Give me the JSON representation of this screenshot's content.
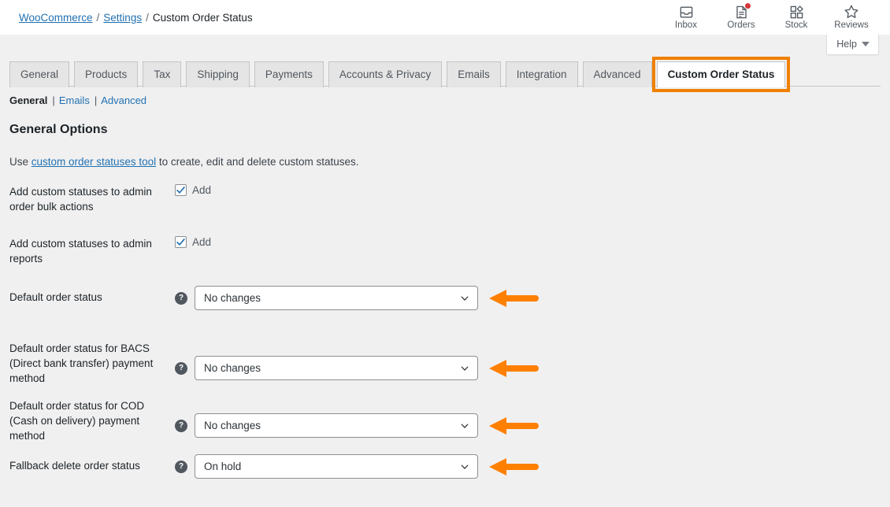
{
  "header": {
    "breadcrumb": {
      "root_label": "WooCommerce",
      "sep1": "/",
      "settings_label": "Settings",
      "sep2": "/",
      "current_label": "Custom Order Status"
    },
    "icons": [
      {
        "label": "Inbox",
        "icon": "inbox-icon",
        "badge": false
      },
      {
        "label": "Orders",
        "icon": "orders-icon",
        "badge": true
      },
      {
        "label": "Stock",
        "icon": "stock-icon",
        "badge": false
      },
      {
        "label": "Reviews",
        "icon": "reviews-star-icon",
        "badge": false
      }
    ],
    "help_label": "Help"
  },
  "tabs": [
    {
      "label": "General",
      "active": false
    },
    {
      "label": "Products",
      "active": false
    },
    {
      "label": "Tax",
      "active": false
    },
    {
      "label": "Shipping",
      "active": false
    },
    {
      "label": "Payments",
      "active": false
    },
    {
      "label": "Accounts & Privacy",
      "active": false
    },
    {
      "label": "Emails",
      "active": false
    },
    {
      "label": "Integration",
      "active": false
    },
    {
      "label": "Advanced",
      "active": false
    },
    {
      "label": "Custom Order Status",
      "active": true
    }
  ],
  "subnav": {
    "items": [
      {
        "label": "General",
        "active": true
      },
      {
        "label": "Emails",
        "active": false
      },
      {
        "label": "Advanced",
        "active": false
      }
    ],
    "separator": "|"
  },
  "section": {
    "title": "General Options",
    "desc_before": "Use ",
    "desc_link": "custom order statuses tool",
    "desc_after": " to create, edit and delete custom statuses."
  },
  "checkbox_rows": [
    {
      "label": "Add custom statuses to admin order bulk actions",
      "checkbox_label": "Add",
      "checked": true
    },
    {
      "label": "Add custom statuses to admin reports",
      "checkbox_label": "Add",
      "checked": true
    }
  ],
  "select_rows": [
    {
      "label": "Default order status",
      "help": "?",
      "value": "No changes",
      "annotated": true
    },
    {
      "label": "Default order status for BACS (Direct bank transfer) payment method",
      "help": "?",
      "value": "No changes",
      "annotated": true
    },
    {
      "label": "Default order status for COD (Cash on delivery) payment method",
      "help": "?",
      "value": "No changes",
      "annotated": true
    },
    {
      "label": "Fallback delete order status",
      "help": "?",
      "value": "On hold",
      "annotated": true
    }
  ],
  "colors": {
    "annotation_orange": "#f08000",
    "link_blue": "#2271b1",
    "checkbox_blue": "#2271b1",
    "badge_red": "#d63638",
    "page_bg": "#f0f0f1"
  }
}
